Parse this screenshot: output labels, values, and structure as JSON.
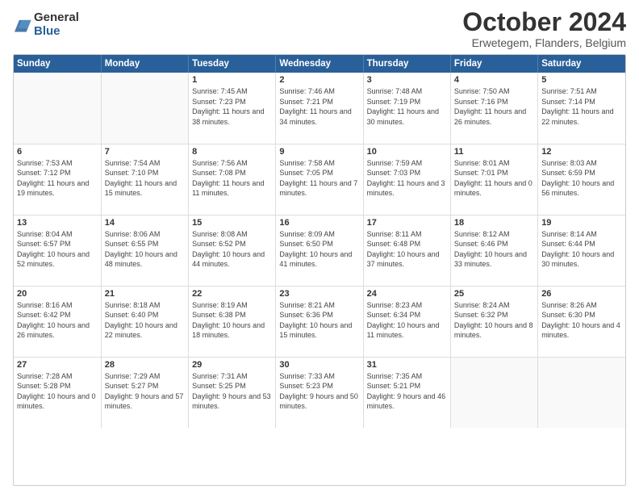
{
  "header": {
    "logo": {
      "general": "General",
      "blue": "Blue"
    },
    "title": "October 2024",
    "subtitle": "Erwetegem, Flanders, Belgium"
  },
  "days_of_week": [
    "Sunday",
    "Monday",
    "Tuesday",
    "Wednesday",
    "Thursday",
    "Friday",
    "Saturday"
  ],
  "weeks": [
    [
      {
        "num": "",
        "info": ""
      },
      {
        "num": "",
        "info": ""
      },
      {
        "num": "1",
        "info": "Sunrise: 7:45 AM\nSunset: 7:23 PM\nDaylight: 11 hours and 38 minutes."
      },
      {
        "num": "2",
        "info": "Sunrise: 7:46 AM\nSunset: 7:21 PM\nDaylight: 11 hours and 34 minutes."
      },
      {
        "num": "3",
        "info": "Sunrise: 7:48 AM\nSunset: 7:19 PM\nDaylight: 11 hours and 30 minutes."
      },
      {
        "num": "4",
        "info": "Sunrise: 7:50 AM\nSunset: 7:16 PM\nDaylight: 11 hours and 26 minutes."
      },
      {
        "num": "5",
        "info": "Sunrise: 7:51 AM\nSunset: 7:14 PM\nDaylight: 11 hours and 22 minutes."
      }
    ],
    [
      {
        "num": "6",
        "info": "Sunrise: 7:53 AM\nSunset: 7:12 PM\nDaylight: 11 hours and 19 minutes."
      },
      {
        "num": "7",
        "info": "Sunrise: 7:54 AM\nSunset: 7:10 PM\nDaylight: 11 hours and 15 minutes."
      },
      {
        "num": "8",
        "info": "Sunrise: 7:56 AM\nSunset: 7:08 PM\nDaylight: 11 hours and 11 minutes."
      },
      {
        "num": "9",
        "info": "Sunrise: 7:58 AM\nSunset: 7:05 PM\nDaylight: 11 hours and 7 minutes."
      },
      {
        "num": "10",
        "info": "Sunrise: 7:59 AM\nSunset: 7:03 PM\nDaylight: 11 hours and 3 minutes."
      },
      {
        "num": "11",
        "info": "Sunrise: 8:01 AM\nSunset: 7:01 PM\nDaylight: 11 hours and 0 minutes."
      },
      {
        "num": "12",
        "info": "Sunrise: 8:03 AM\nSunset: 6:59 PM\nDaylight: 10 hours and 56 minutes."
      }
    ],
    [
      {
        "num": "13",
        "info": "Sunrise: 8:04 AM\nSunset: 6:57 PM\nDaylight: 10 hours and 52 minutes."
      },
      {
        "num": "14",
        "info": "Sunrise: 8:06 AM\nSunset: 6:55 PM\nDaylight: 10 hours and 48 minutes."
      },
      {
        "num": "15",
        "info": "Sunrise: 8:08 AM\nSunset: 6:52 PM\nDaylight: 10 hours and 44 minutes."
      },
      {
        "num": "16",
        "info": "Sunrise: 8:09 AM\nSunset: 6:50 PM\nDaylight: 10 hours and 41 minutes."
      },
      {
        "num": "17",
        "info": "Sunrise: 8:11 AM\nSunset: 6:48 PM\nDaylight: 10 hours and 37 minutes."
      },
      {
        "num": "18",
        "info": "Sunrise: 8:12 AM\nSunset: 6:46 PM\nDaylight: 10 hours and 33 minutes."
      },
      {
        "num": "19",
        "info": "Sunrise: 8:14 AM\nSunset: 6:44 PM\nDaylight: 10 hours and 30 minutes."
      }
    ],
    [
      {
        "num": "20",
        "info": "Sunrise: 8:16 AM\nSunset: 6:42 PM\nDaylight: 10 hours and 26 minutes."
      },
      {
        "num": "21",
        "info": "Sunrise: 8:18 AM\nSunset: 6:40 PM\nDaylight: 10 hours and 22 minutes."
      },
      {
        "num": "22",
        "info": "Sunrise: 8:19 AM\nSunset: 6:38 PM\nDaylight: 10 hours and 18 minutes."
      },
      {
        "num": "23",
        "info": "Sunrise: 8:21 AM\nSunset: 6:36 PM\nDaylight: 10 hours and 15 minutes."
      },
      {
        "num": "24",
        "info": "Sunrise: 8:23 AM\nSunset: 6:34 PM\nDaylight: 10 hours and 11 minutes."
      },
      {
        "num": "25",
        "info": "Sunrise: 8:24 AM\nSunset: 6:32 PM\nDaylight: 10 hours and 8 minutes."
      },
      {
        "num": "26",
        "info": "Sunrise: 8:26 AM\nSunset: 6:30 PM\nDaylight: 10 hours and 4 minutes."
      }
    ],
    [
      {
        "num": "27",
        "info": "Sunrise: 7:28 AM\nSunset: 5:28 PM\nDaylight: 10 hours and 0 minutes."
      },
      {
        "num": "28",
        "info": "Sunrise: 7:29 AM\nSunset: 5:27 PM\nDaylight: 9 hours and 57 minutes."
      },
      {
        "num": "29",
        "info": "Sunrise: 7:31 AM\nSunset: 5:25 PM\nDaylight: 9 hours and 53 minutes."
      },
      {
        "num": "30",
        "info": "Sunrise: 7:33 AM\nSunset: 5:23 PM\nDaylight: 9 hours and 50 minutes."
      },
      {
        "num": "31",
        "info": "Sunrise: 7:35 AM\nSunset: 5:21 PM\nDaylight: 9 hours and 46 minutes."
      },
      {
        "num": "",
        "info": ""
      },
      {
        "num": "",
        "info": ""
      }
    ]
  ]
}
